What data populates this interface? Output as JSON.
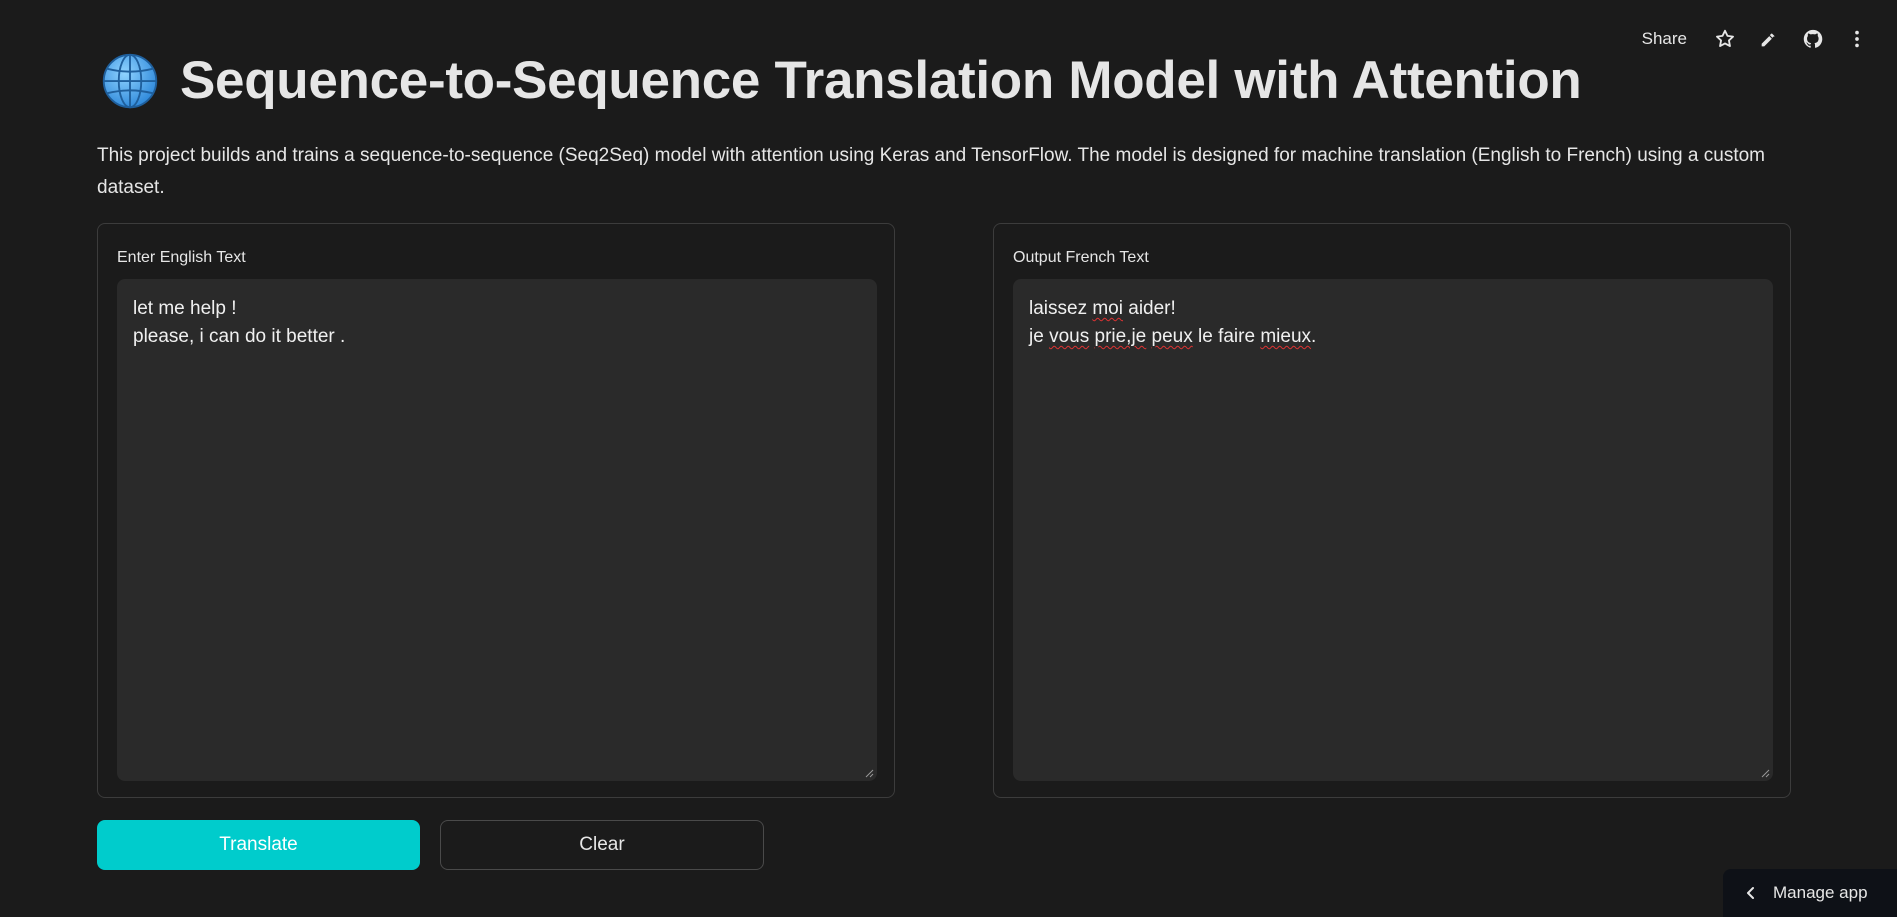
{
  "toolbar": {
    "share_label": "Share",
    "icons": [
      "star-icon",
      "pencil-icon",
      "github-icon",
      "more-vertical-icon"
    ]
  },
  "header": {
    "icon": "globe-icon",
    "title": "Sequence-to-Sequence Translation Model with Attention",
    "description": "This project builds and trains a sequence-to-sequence (Seq2Seq) model with attention using Keras and TensorFlow. The model is designed for machine translation (English to French) using a custom dataset."
  },
  "input_panel": {
    "label": "Enter English Text",
    "lines": [
      "let me help !",
      "please, i can do it better ."
    ]
  },
  "output_panel": {
    "label": "Output French Text",
    "line1": {
      "a": "laissez ",
      "moi": "moi",
      "b": " aider!"
    },
    "line2": {
      "a": "je ",
      "vous": "vous",
      "b": " ",
      "prie": "prie,je",
      "c": " ",
      "peux": "peux",
      "d": " le faire ",
      "mieux": "mieux",
      "e": "."
    }
  },
  "buttons": {
    "translate_label": "Translate",
    "clear_label": "Clear"
  },
  "manage_app": {
    "label": "Manage app",
    "icon": "chevron-left-icon"
  },
  "colors": {
    "background": "#1b1b1b",
    "textarea_bg": "#2a2a2a",
    "accent": "#00cccc",
    "text": "#e6e6e6"
  }
}
